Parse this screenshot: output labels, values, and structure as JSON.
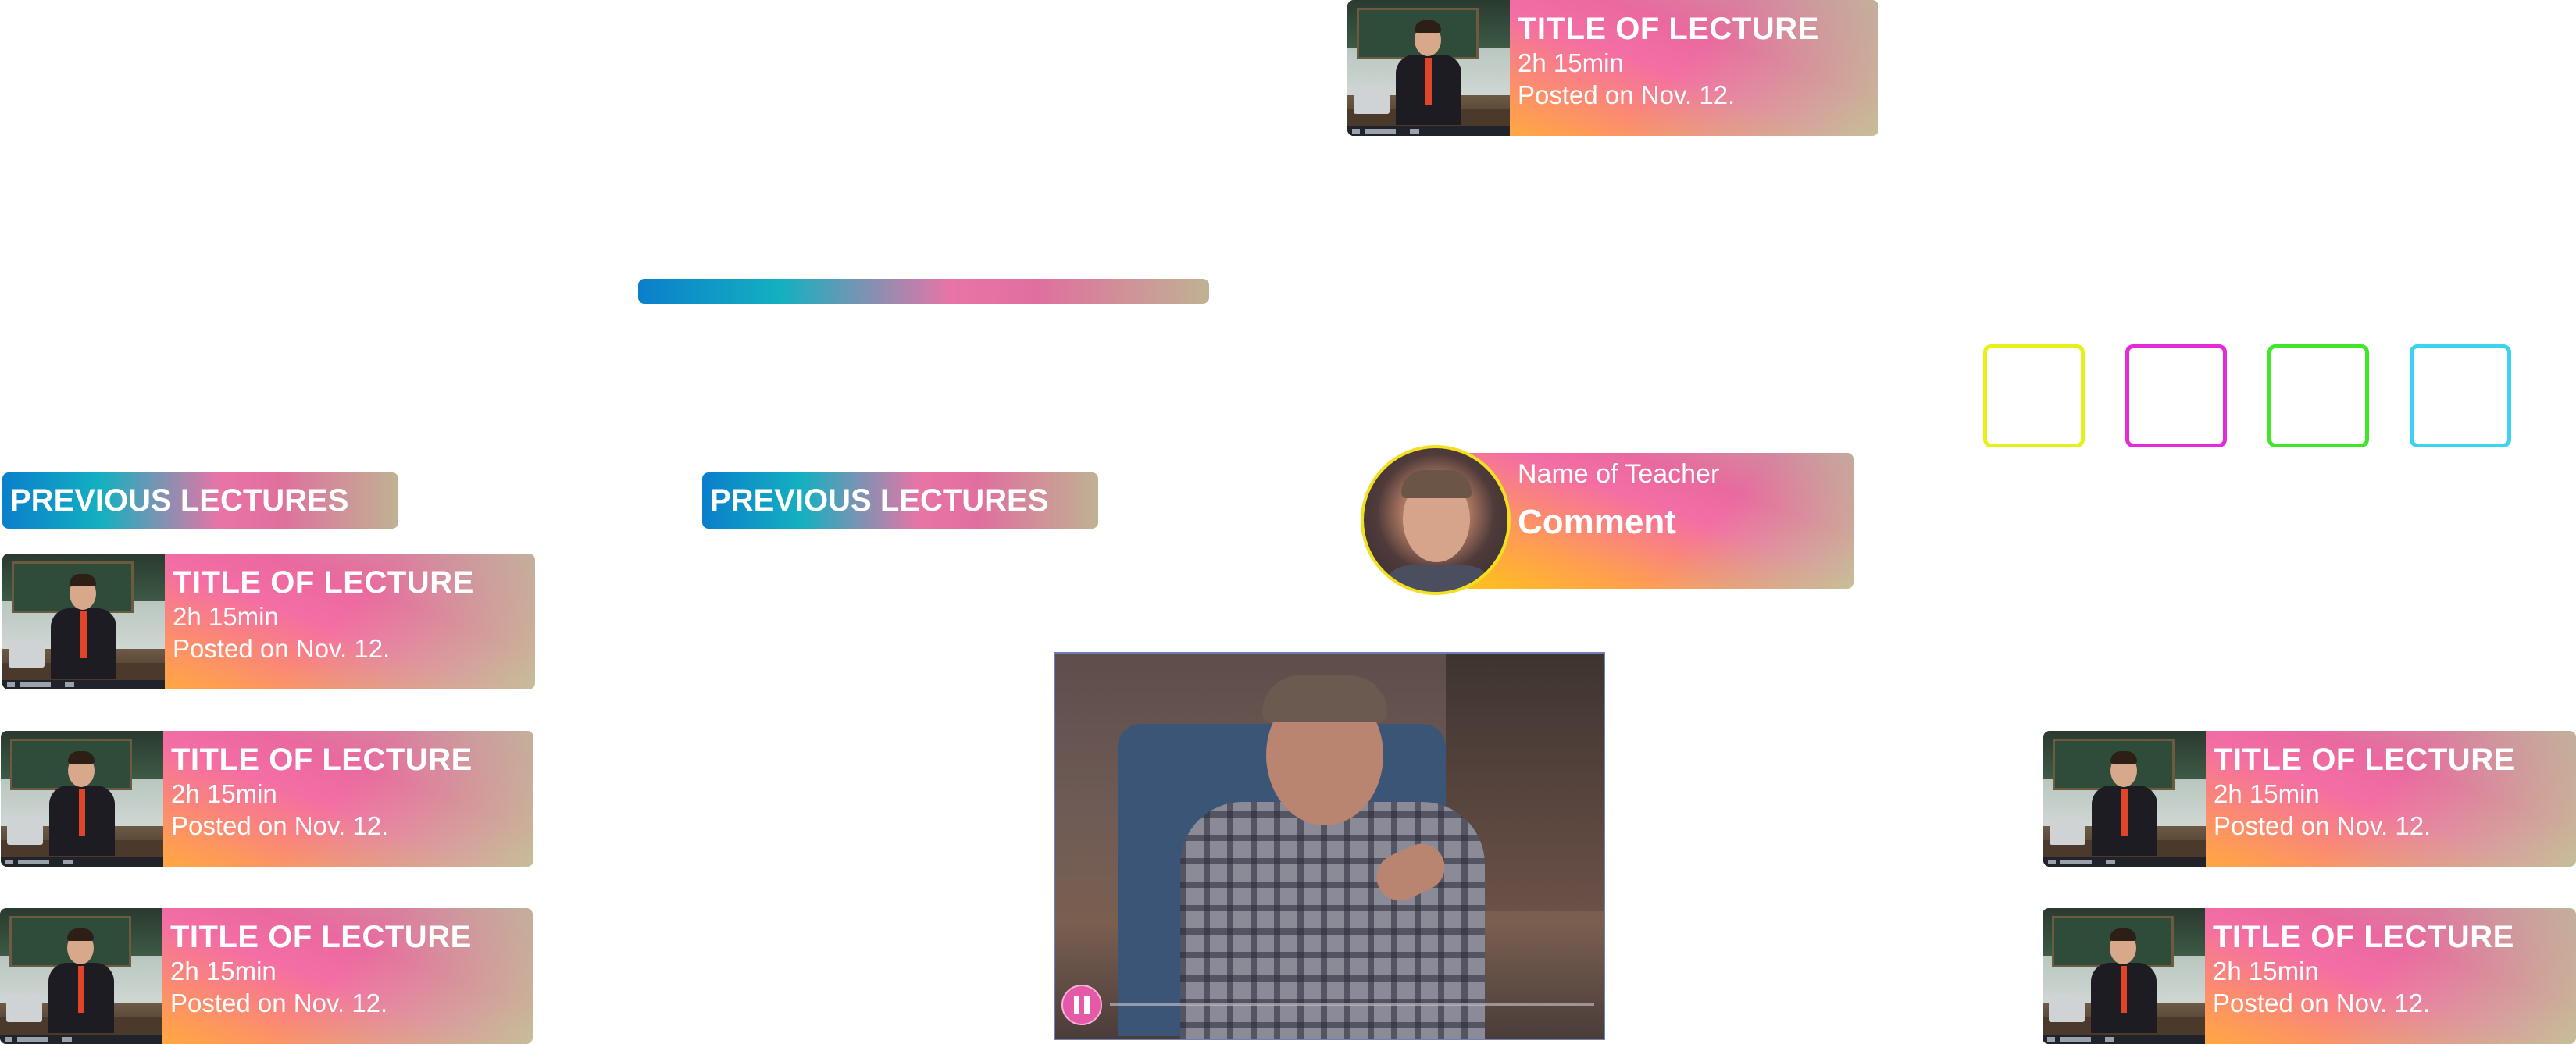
{
  "lecture": {
    "title": "TITLE OF LECTURE",
    "duration": "2h 15min",
    "posted": "Posted on Nov. 12."
  },
  "sections": {
    "previous_lectures_left": "PREVIOUS LECTURES",
    "previous_lectures_center": "PREVIOUS LECTURES"
  },
  "teacher": {
    "name": "Name of Teacher",
    "comment": "Comment"
  },
  "colors": {
    "swatch_yellow": "#e6f01a",
    "swatch_magenta": "#e42bd8",
    "swatch_green": "#3fe62a",
    "swatch_cyan": "#3bd3ee",
    "avatar_border": "#f2e020",
    "play_button": "#e45aa8"
  },
  "icons": {
    "video_control": "pause-icon"
  }
}
